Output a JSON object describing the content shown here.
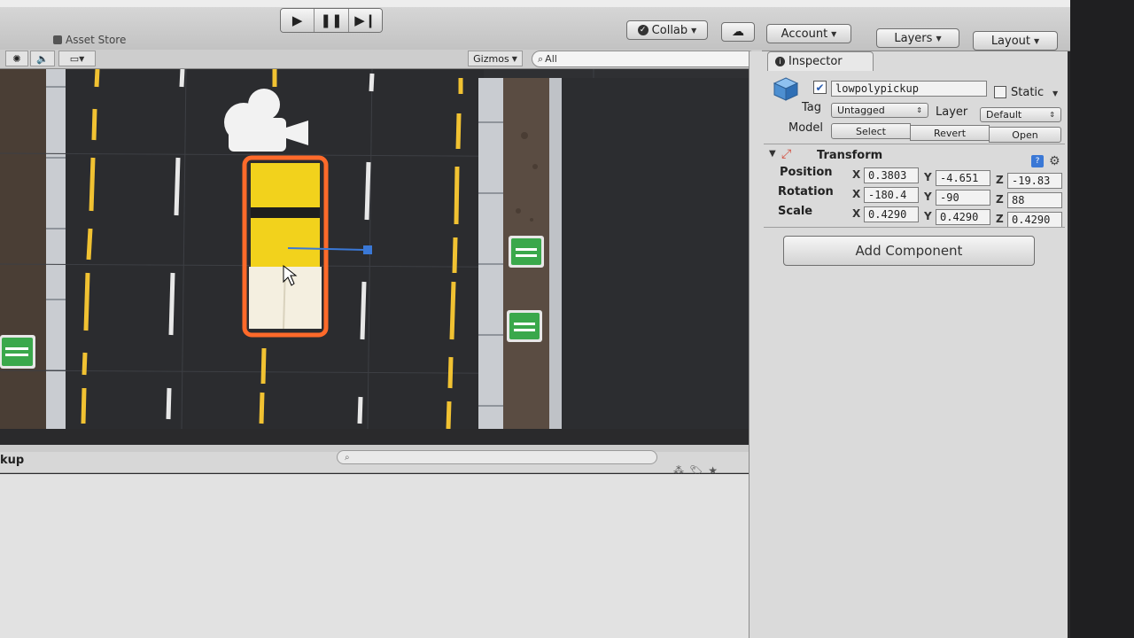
{
  "toolbar": {
    "collab_label": "Collab",
    "account_label": "Account",
    "layers_label": "Layers",
    "layout_label": "Layout",
    "play_icon": "play-icon",
    "pause_icon": "pause-icon",
    "step_icon": "step-icon"
  },
  "tabs": {
    "asset_store": "Asset Store"
  },
  "scene": {
    "gizmos_label": "Gizmos",
    "search_value": "All"
  },
  "project": {
    "panel_label": "kup",
    "search_placeholder": ""
  },
  "inspector": {
    "tab_label": "Inspector",
    "object_name": "lowpolypickup",
    "static_label": "Static",
    "tag_label": "Tag",
    "tag_value": "Untagged",
    "layer_label": "Layer",
    "layer_value": "Default",
    "model_label": "Model",
    "model_buttons": [
      "Select",
      "Revert",
      "Open"
    ],
    "component_title": "Transform",
    "rows": [
      {
        "label": "Position",
        "x": "0.3803",
        "y": "-4.651",
        "z": "-19.83"
      },
      {
        "label": "Rotation",
        "x": "-180.4",
        "y": "-90",
        "z": "88"
      },
      {
        "label": "Scale",
        "x": "0.4290",
        "y": "0.4290",
        "z": "0.4290"
      }
    ],
    "axis_labels": [
      "X",
      "Y",
      "Z"
    ],
    "add_component_label": "Add Component"
  },
  "colors": {
    "accent": "#3a78d6",
    "car_yellow": "#f2d21c",
    "selection_orange": "#ff6a2a",
    "road": "#2d2e31",
    "sign_green": "#3aa84b"
  }
}
